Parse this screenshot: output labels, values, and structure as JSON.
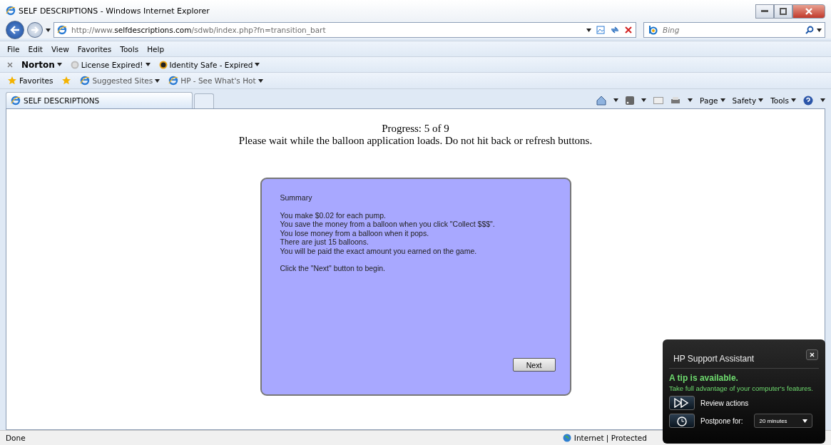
{
  "window": {
    "title": "SELF DESCRIPTIONS - Windows Internet Explorer"
  },
  "address_bar": {
    "url": "http://www.**selfdescriptions.com**/sdwb/index.php?fn=transition_bart",
    "search_placeholder": "Bing"
  },
  "menu": [
    "File",
    "Edit",
    "View",
    "Favorites",
    "Tools",
    "Help"
  ],
  "norton_toolbar": {
    "brand": "Norton",
    "items": [
      "License Expired!",
      "Identity Safe - Expired"
    ]
  },
  "favorites_bar": {
    "label": "Favorites",
    "items": [
      "Suggested Sites",
      "HP - See What's Hot"
    ]
  },
  "tabs": [
    {
      "label": "SELF DESCRIPTIONS",
      "selected": true
    }
  ],
  "command_bar": [
    "Page",
    "Safety",
    "Tools"
  ],
  "page": {
    "progress": "Progress: 5 of 9",
    "notice": "Please wait while the balloon application loads. Do not hit back or refresh buttons.",
    "summary": {
      "title": "Summary",
      "lines": [
        "You make $0.02 for each pump.",
        "You save the money from a balloon when you click \"Collect $$$\".",
        "You lose money from a balloon when it pops.",
        "There are just 15 balloons.",
        "You will be paid the exact amount you earned on the game."
      ],
      "footer": "Click the \"Next\" button to begin.",
      "button": "Next"
    }
  },
  "status_bar": {
    "text": "Done",
    "zone": "Internet | Protected"
  },
  "hp_popup": {
    "title": "HP Support Assistant",
    "heading": "A tip is available.",
    "text": "Take full advantage of your computer's features.",
    "review": "Review actions",
    "postpone_label": "Postpone for:",
    "postpone_value": "20 minutes"
  }
}
